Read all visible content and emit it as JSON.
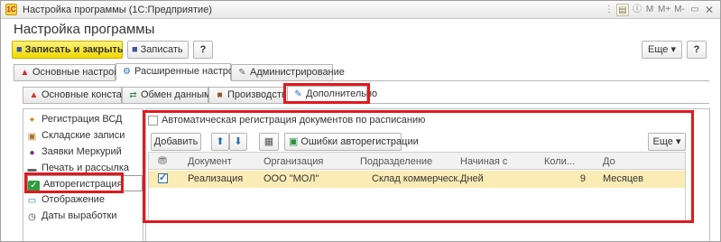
{
  "window": {
    "title": "Настройка программы (1С:Предприятие)",
    "title_controls": [
      "M",
      "M+",
      "M-"
    ]
  },
  "page": {
    "heading": "Настройка программы"
  },
  "toolbar": {
    "save_close_label": "Записать и закрыть",
    "save_label": "Записать",
    "help_label": "?",
    "more_label": "Еще ▾",
    "help_right_label": "?"
  },
  "main_tabs": [
    {
      "label": "Основные настройки",
      "icon": "warning-icon"
    },
    {
      "label": "Расширенные настройки",
      "icon": "user-settings-icon",
      "active": true
    },
    {
      "label": "Администрирование",
      "icon": "tools-icon"
    }
  ],
  "sub_tabs": [
    {
      "label": "Основные константы",
      "icon": "warning-icon"
    },
    {
      "label": "Обмен данными",
      "icon": "exchange-icon"
    },
    {
      "label": "Производство",
      "icon": "factory-icon"
    },
    {
      "label": "Дополнительно",
      "icon": "wrench-icon",
      "active": true
    }
  ],
  "nav": [
    {
      "label": "Регистрация ВСД",
      "icon": "vsd-icon"
    },
    {
      "label": "Складские записи",
      "icon": "warehouse-icon"
    },
    {
      "label": "Заявки Меркурий",
      "icon": "mercury-icon"
    },
    {
      "label": "Печать и рассылка",
      "icon": "printer-icon"
    },
    {
      "label": "Авторегистрация",
      "icon": "check-icon",
      "active": true
    },
    {
      "label": "Отображение",
      "icon": "display-icon"
    },
    {
      "label": "Даты выработки",
      "icon": "clock-icon"
    }
  ],
  "content": {
    "auto_reg_checkbox_label": "Автоматическая регистрация документов по расписанию",
    "auto_reg_checked": false,
    "add_button": "Добавить",
    "errors_button": "Ошибки авторегистрации",
    "more_label": "Еще ▾"
  },
  "table": {
    "columns": [
      "Документ",
      "Организация",
      "Подразделение",
      "Начиная с",
      "Коли...",
      "До"
    ],
    "rows": [
      {
        "checked": true,
        "document": "Реализация",
        "organization": "ООО \"МОЛ\"",
        "division": "Склад коммерческ...",
        "starting_from": "Дней",
        "quantity": "9",
        "until": "Месяцев"
      }
    ]
  },
  "colors": {
    "accent_red": "#e0191e",
    "primary_button": "#f0d800",
    "selected_row": "#fbecb5"
  }
}
